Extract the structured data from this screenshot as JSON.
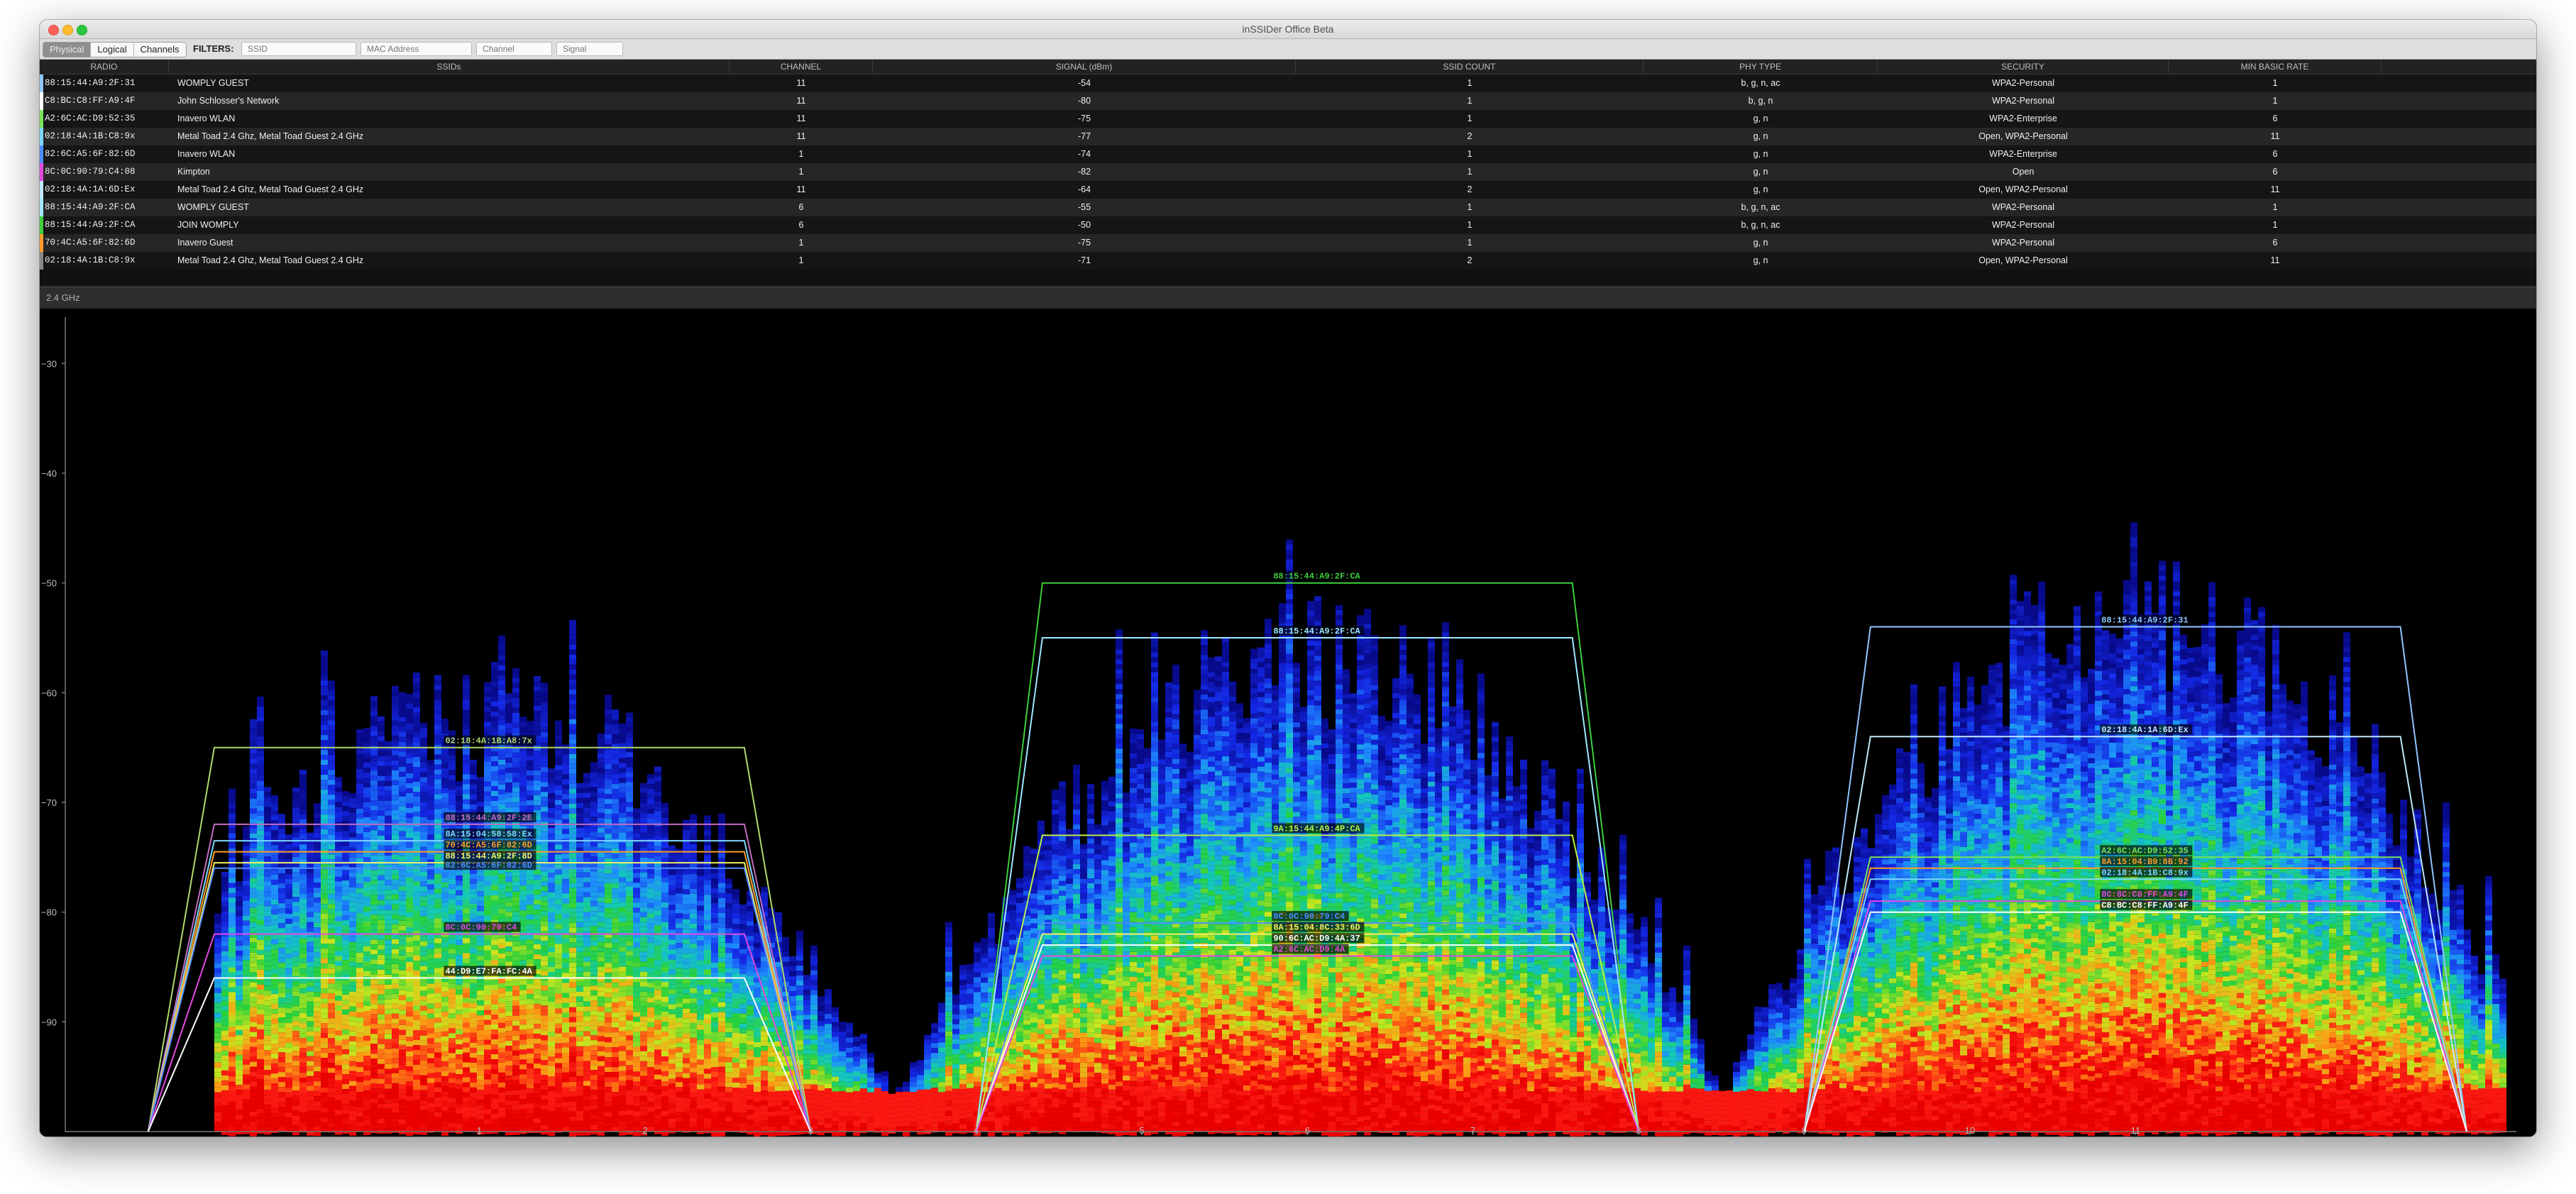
{
  "window": {
    "title": "inSSIDer Office Beta"
  },
  "toolbar": {
    "views": [
      {
        "label": "Physical",
        "active": true
      },
      {
        "label": "Logical",
        "active": false
      },
      {
        "label": "Channels",
        "active": false
      }
    ],
    "filters_label": "FILTERS:",
    "filters": [
      {
        "placeholder": "SSID"
      },
      {
        "placeholder": "MAC Address"
      },
      {
        "placeholder": "Channel"
      },
      {
        "placeholder": "Signal"
      }
    ]
  },
  "table": {
    "columns": [
      "RADIO",
      "SSIDs",
      "CHANNEL",
      "SIGNAL (dBm)",
      "SSID COUNT",
      "PHY TYPE",
      "SECURITY",
      "MIN BASIC RATE"
    ],
    "rows": [
      {
        "color": "#8ec6ff",
        "radio": "88:15:44:A9:2F:31",
        "ssids": "WOMPLY GUEST",
        "channel": "11",
        "signal": "-54",
        "ssid_count": "1",
        "phy": "b, g, n, ac",
        "security": "WPA2-Personal",
        "rate": "1"
      },
      {
        "color": "#ffffff",
        "radio": "C8:BC:C8:FF:A9:4F",
        "ssids": "John Schlosser's Network",
        "channel": "11",
        "signal": "-80",
        "ssid_count": "1",
        "phy": "b, g, n",
        "security": "WPA2-Personal",
        "rate": "1"
      },
      {
        "color": "#7be35a",
        "radio": "A2:6C:AC:D9:52:35",
        "ssids": "Inavero WLAN",
        "channel": "11",
        "signal": "-75",
        "ssid_count": "1",
        "phy": "g, n",
        "security": "WPA2-Enterprise",
        "rate": "6"
      },
      {
        "color": "#7fd7ff",
        "radio": "02:18:4A:1B:C8:9x",
        "ssids": "Metal Toad 2.4 Ghz, Metal Toad Guest 2.4 GHz",
        "channel": "11",
        "signal": "-77",
        "ssid_count": "2",
        "phy": "g, n",
        "security": "Open, WPA2-Personal",
        "rate": "11"
      },
      {
        "color": "#4f8cff",
        "radio": "82:6C:A5:6F:82:6D",
        "ssids": "Inavero WLAN",
        "channel": "1",
        "signal": "-74",
        "ssid_count": "1",
        "phy": "g, n",
        "security": "WPA2-Enterprise",
        "rate": "6"
      },
      {
        "color": "#e049e0",
        "radio": "8C:0C:90:79:C4:08",
        "ssids": "Kimpton",
        "channel": "1",
        "signal": "-82",
        "ssid_count": "1",
        "phy": "g, n",
        "security": "Open",
        "rate": "6"
      },
      {
        "color": "#bfe9ff",
        "radio": "02:18:4A:1A:6D:Ex",
        "ssids": "Metal Toad 2.4 Ghz, Metal Toad Guest 2.4 GHz",
        "channel": "11",
        "signal": "-64",
        "ssid_count": "2",
        "phy": "g, n",
        "security": "Open, WPA2-Personal",
        "rate": "11"
      },
      {
        "color": "#9fe8ff",
        "radio": "88:15:44:A9:2F:CA",
        "ssids": "WOMPLY GUEST",
        "channel": "6",
        "signal": "-55",
        "ssid_count": "1",
        "phy": "b, g, n, ac",
        "security": "WPA2-Personal",
        "rate": "1"
      },
      {
        "color": "#3dcf3d",
        "radio": "88:15:44:A9:2F:CA",
        "ssids": "JOIN WOMPLY",
        "channel": "6",
        "signal": "-50",
        "ssid_count": "1",
        "phy": "b, g, n, ac",
        "security": "WPA2-Personal",
        "rate": "1"
      },
      {
        "color": "#ff9c2a",
        "radio": "70:4C:A5:6F:82:6D",
        "ssids": "Inavero Guest",
        "channel": "1",
        "signal": "-75",
        "ssid_count": "1",
        "phy": "g, n",
        "security": "WPA2-Personal",
        "rate": "6"
      },
      {
        "color": "#888888",
        "radio": "02:18:4A:1B:C8:9x",
        "ssids": "Metal Toad 2.4 Ghz, Metal Toad Guest 2.4 GHz",
        "channel": "1",
        "signal": "-71",
        "ssid_count": "2",
        "phy": "g, n",
        "security": "Open, WPA2-Personal",
        "rate": "11"
      }
    ]
  },
  "section": {
    "label": "2.4 GHz"
  },
  "colors": {
    "window_bg": "#1b1b1b",
    "spectrum_low": "#0010c8",
    "spectrum_mid": "#20d020",
    "spectrum_high": "#ff1010"
  },
  "chart_data": {
    "type": "area",
    "title": "",
    "xlabel": "",
    "ylabel": "",
    "x_ticks": [
      1,
      2,
      3,
      4,
      5,
      6,
      7,
      8,
      9,
      10,
      11
    ],
    "x_tick_labels": [
      "1",
      "2",
      "3",
      "4",
      "5",
      "6",
      "7",
      "8",
      "9",
      "10",
      "11"
    ],
    "xlim": [
      -1.5,
      13.3
    ],
    "y_ticks": [
      -30,
      -40,
      -50,
      -60,
      -70,
      -80,
      -90
    ],
    "y_tick_labels": [
      "−30",
      "−40",
      "−50",
      "−60",
      "−70",
      "−80",
      "−90"
    ],
    "ylim": [
      -100,
      -25
    ],
    "grid": false,
    "networks": [
      {
        "name": "02:18:4A:1B:A8:7x",
        "channel": 1,
        "signal": -65,
        "color": "#b0d96c"
      },
      {
        "name": "88:15:44:A9:2F:2E",
        "channel": 1,
        "signal": -72,
        "color": "#c06cc0"
      },
      {
        "name": "8A:15:04:58:58:Ex",
        "channel": 1,
        "signal": -73.5,
        "color": "#7fd7ff"
      },
      {
        "name": "70:4C:A5:6F:82:6D",
        "channel": 1,
        "signal": -74.5,
        "color": "#ff9c2a"
      },
      {
        "name": "88:15:44:A9:2F:8D",
        "channel": 1,
        "signal": -75.5,
        "color": "#f2f06a"
      },
      {
        "name": "82:6C:A5:6F:82:6D",
        "channel": 1,
        "signal": -76,
        "color": "#4f8cff"
      },
      {
        "name": "8C:0C:90:79:C4",
        "channel": 1,
        "signal": -82,
        "color": "#e049e0"
      },
      {
        "name": "44:D9:E7:FA:FC:4A",
        "channel": 1,
        "signal": -86,
        "color": "#ffffff"
      },
      {
        "name": "88:15:44:A9:2F:CA",
        "channel": 6,
        "signal": -50,
        "color": "#3dcf3d"
      },
      {
        "name": "88:15:44:A9:2F:CA",
        "channel": 6,
        "signal": -55,
        "color": "#9fe8ff"
      },
      {
        "name": "9A:15:44:A9:4P:CA",
        "channel": 6,
        "signal": -73,
        "color": "#b9f04a"
      },
      {
        "name": "8C:0C:90:79:C4",
        "channel": 6,
        "signal": -81,
        "color": "#4f8cff"
      },
      {
        "name": "8A:15:04:8C:33:6D",
        "channel": 6,
        "signal": -82,
        "color": "#f2f06a"
      },
      {
        "name": "90:6C:AC:D9:4A:37",
        "channel": 6,
        "signal": -83,
        "color": "#ffffff"
      },
      {
        "name": "A2:6C:AC:D9:4A",
        "channel": 6,
        "signal": -84,
        "color": "#e049e0"
      },
      {
        "name": "88:15:44:A9:2F:31",
        "channel": 11,
        "signal": -54,
        "color": "#8ec6ff"
      },
      {
        "name": "02:18:4A:1A:6D:Ex",
        "channel": 11,
        "signal": -64,
        "color": "#bfe9ff"
      },
      {
        "name": "A2:6C:AC:D9:52:35",
        "channel": 11,
        "signal": -75,
        "color": "#7be35a"
      },
      {
        "name": "8A:15:04:B9:8B:92",
        "channel": 11,
        "signal": -76,
        "color": "#ff9c2a"
      },
      {
        "name": "02:18:4A:1B:C8:9x",
        "channel": 11,
        "signal": -77,
        "color": "#7fd7ff"
      },
      {
        "name": "8C:8C:C8:FF:A9:4F",
        "channel": 11,
        "signal": -79,
        "color": "#e049e0"
      },
      {
        "name": "C8:BC:C8:FF:A9:4F",
        "channel": 11,
        "signal": -80,
        "color": "#ffffff"
      }
    ]
  }
}
